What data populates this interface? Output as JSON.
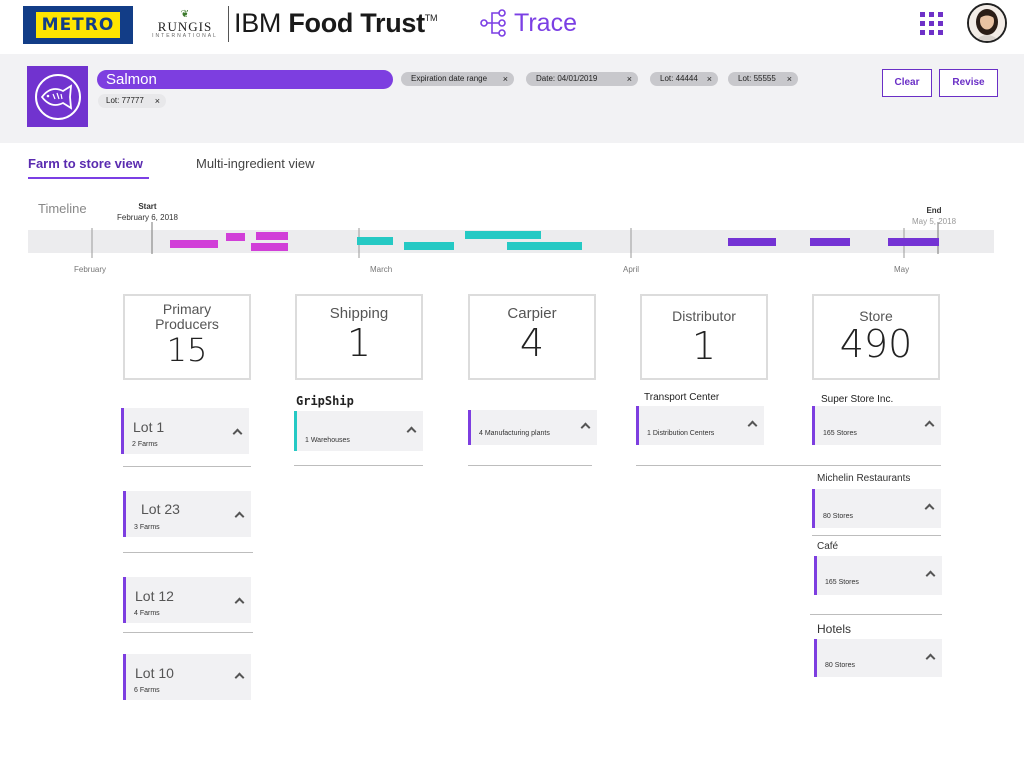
{
  "header": {
    "metro_logo": "METRO",
    "rungis_logo": "RUNGIS",
    "rungis_sub": "INTERNATIONAL",
    "brand_light": "IBM ",
    "brand_bold": "Food Trust",
    "brand_tm": "TM",
    "app_name": "Trace",
    "app_switcher_icon": "grid-icon",
    "avatar_icon": "user-avatar"
  },
  "filters": {
    "product_icon": "fish-icon",
    "product": "Salmon",
    "chips": [
      "Expiration date range",
      "Date: 04/01/2019",
      "Lot: 44444",
      "Lot: 55555"
    ],
    "lot_chip": "Lot: 77777",
    "close_glyph": "×",
    "clear_label": "Clear",
    "revise_label": "Revise"
  },
  "tabs": [
    {
      "label": "Farm to store view",
      "active": true
    },
    {
      "label": "Multi-ingredient view",
      "active": false
    }
  ],
  "timeline": {
    "label": "Timeline",
    "start_label": "Start",
    "start_date": "February 6, 2018",
    "end_label": "End",
    "end_date": "May 5, 2018",
    "months": [
      "February",
      "March",
      "April",
      "May"
    ],
    "colors": {
      "producer": "#d13fd8",
      "shipping": "#25c9c4",
      "store": "#7433d4"
    }
  },
  "stages": [
    {
      "name_line1": "Primary",
      "name_line2": "Producers",
      "count": "15"
    },
    {
      "name_line1": "Shipping",
      "name_line2": "",
      "count": "1"
    },
    {
      "name_line1": "Carpier",
      "name_line2": "",
      "count": "4"
    },
    {
      "name_line1": "Distributor",
      "name_line2": "",
      "count": "1"
    },
    {
      "name_line1": "Store",
      "name_line2": "",
      "count": "490"
    }
  ],
  "producers": [
    {
      "title": "Lot 1",
      "sub": "2 Farms"
    },
    {
      "title": "Lot 23",
      "sub": "3 Farms"
    },
    {
      "title": "Lot 12",
      "sub": "4 Farms"
    },
    {
      "title": "Lot 10",
      "sub": "6 Farms"
    }
  ],
  "shipping": {
    "group": "GripShip",
    "card": "1 Warehouses"
  },
  "carrier": {
    "card": "4 Manufacturing plants"
  },
  "distributor": {
    "group": "Transport Center",
    "card": "1 Distribution Centers"
  },
  "stores": [
    {
      "group": "Super Store Inc.",
      "card": "165 Stores"
    },
    {
      "group": "Michelin Restaurants",
      "card": "80 Stores"
    },
    {
      "group": "Café",
      "card": "165 Stores"
    },
    {
      "group": "Hotels",
      "card": "80 Stores"
    }
  ]
}
